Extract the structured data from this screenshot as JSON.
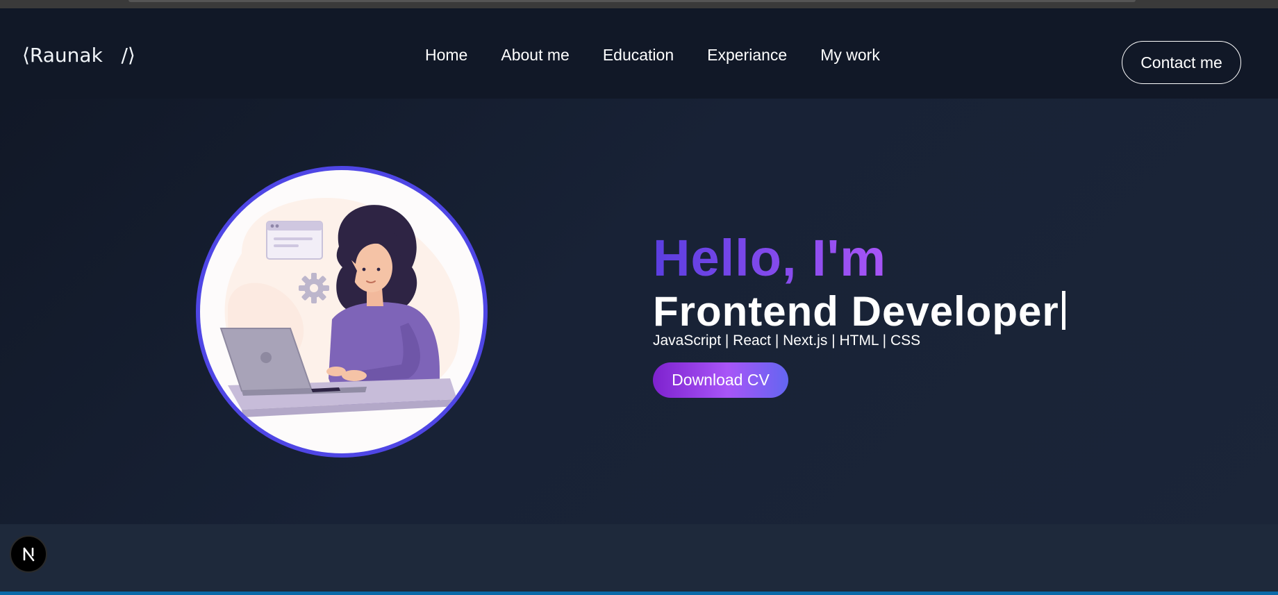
{
  "navbar": {
    "logo_text": "⟨Raunak   /⟩",
    "links": [
      "Home",
      "About me",
      "Education",
      "Experiance",
      "My work"
    ],
    "contact_label": "Contact me"
  },
  "hero": {
    "greeting": "Hello, I'm",
    "role": "Frontend Developer",
    "skills": "JavaScript | React | Next.js | HTML | CSS",
    "download_label": "Download CV",
    "illustration": "woman-working-on-laptop-illustration"
  },
  "dev_badge": {
    "icon": "nextjs-icon",
    "letter": "N"
  },
  "colors": {
    "accent": "#4f46e5",
    "gradient_start": "#5b3ee0",
    "gradient_end": "#a855f7",
    "background": "#111827"
  }
}
